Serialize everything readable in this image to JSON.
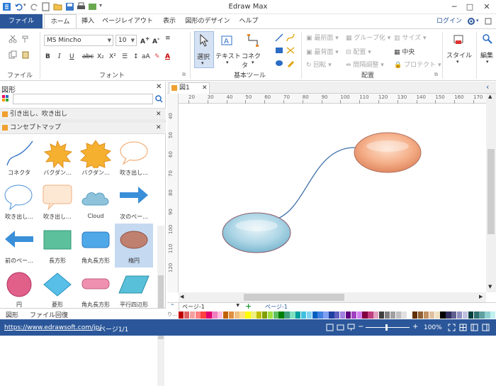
{
  "app": {
    "title": "Edraw Max"
  },
  "tabs": [
    "ファイル",
    "ホーム",
    "挿入",
    "ページレイアウト",
    "表示",
    "図形のデザイン",
    "ヘルプ"
  ],
  "login_label": "ログイン",
  "ribbon": {
    "file_group": "ファイル",
    "font_group": "フォント",
    "tools_group": "基本ツール",
    "arrange_group": "配置",
    "font_name": "MS Mincho",
    "font_size": "10",
    "select_label": "選択",
    "text_label": "テキスト",
    "connector_label": "コネクタ",
    "front_label": "最前面",
    "back_label": "最背面",
    "rotate_label": "回転",
    "group_label": "グループ化",
    "align_label": "配置",
    "spacing_label": "間隔調整",
    "size_label": "サイズ",
    "center_label": "中央",
    "protect_label": "プロテクト",
    "style_label": "スタイル",
    "edit_label": "編集"
  },
  "left_panel": {
    "header": "図形",
    "libraries": [
      "引き出し、吹き出し",
      "コンセプトマップ"
    ],
    "shapes": [
      "コネクタ",
      "バクダン...",
      "バクダン...",
      "吹き出し...",
      "吹き出し...",
      "吹き出し...",
      "Cloud",
      "次のペー...",
      "前のペー...",
      "長方形",
      "角丸長方形",
      "楕円",
      "円",
      "菱形",
      "角丸長方形",
      "平行四辺形"
    ],
    "bottom_tabs": [
      "図形",
      "ファイル回復"
    ]
  },
  "document": {
    "tab": "図1",
    "page_label": "ページ-1",
    "page_tab": "ページ-1"
  },
  "rulers": {
    "h": [
      "20",
      "30",
      "40",
      "50",
      "60",
      "70",
      "80",
      "90",
      "100",
      "110",
      "120",
      "130",
      "140",
      "150",
      "160",
      "170"
    ],
    "v": [
      "40",
      "50",
      "60",
      "70",
      "80",
      "90",
      "100",
      "110",
      "120"
    ]
  },
  "status": {
    "url": "https://www.edrawsoft.com/jp/",
    "page": "ページ1/1",
    "zoom": "100%"
  }
}
